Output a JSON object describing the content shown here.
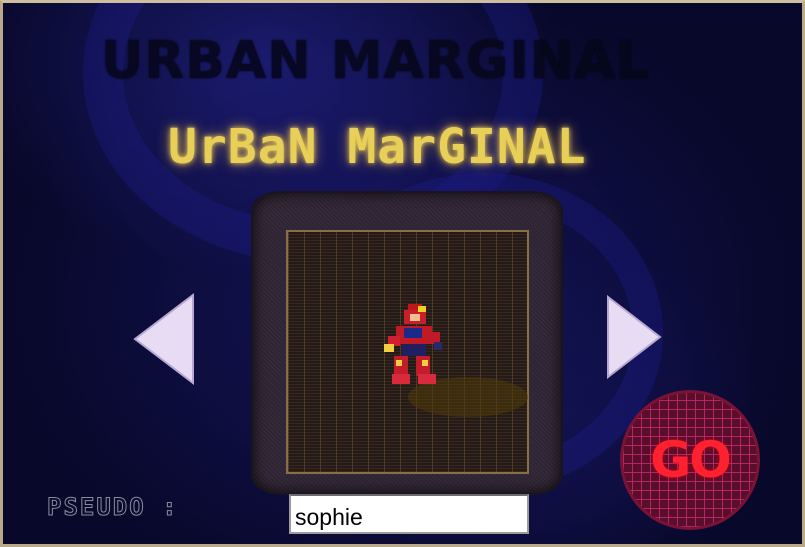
{
  "game": {
    "title_shadow": "URBAN MARGINAL",
    "title_logo": "UrBaN MarGINAL"
  },
  "character_select": {
    "prev_arrow_icon": "triangle-left-icon",
    "next_arrow_icon": "triangle-right-icon",
    "character_sprite": "red-armored-robot-warrior"
  },
  "go_button": {
    "label": "GO"
  },
  "pseudo": {
    "label": "PSEUDO :",
    "value": "sophie"
  },
  "colors": {
    "background": "#0b0b2a",
    "title_gold": "#e8cf58",
    "go_red": "#ff2030",
    "arrow_lilac": "#e8dcf4"
  }
}
